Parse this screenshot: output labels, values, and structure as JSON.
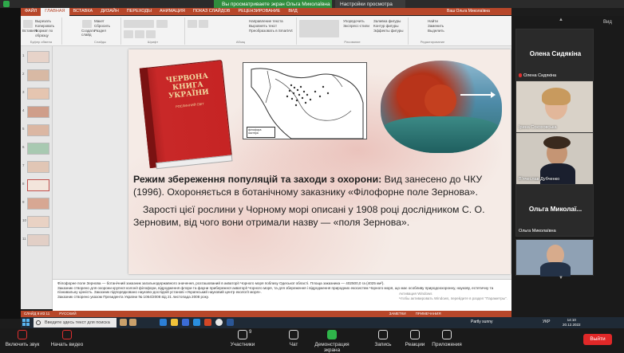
{
  "zoom": {
    "share_banner": "Вы просматриваете экран Ольга Миколаївна",
    "view_options": "Настройки просмотра",
    "view_label": "Вид",
    "toolbar": [
      {
        "label": "Включить звук",
        "icon": "mic-muted-icon"
      },
      {
        "label": "Начать видео",
        "icon": "video-off-icon"
      },
      {
        "label": "Участники",
        "icon": "participants-icon",
        "count": "9"
      },
      {
        "label": "Чат",
        "icon": "chat-icon"
      },
      {
        "label": "Демонстрация экрана",
        "icon": "share-screen-icon"
      },
      {
        "label": "Запись",
        "icon": "record-icon"
      },
      {
        "label": "Реакции",
        "icon": "reactions-icon"
      },
      {
        "label": "Приложения",
        "icon": "apps-icon"
      }
    ],
    "end_label": "Выйти",
    "participants": [
      {
        "name": "Олена Сидякіна",
        "label": "Олена Сидякіна",
        "video": false
      },
      {
        "name": "",
        "label": "Ірина Сокоховська",
        "video": true
      },
      {
        "name": "",
        "label": "В'ячеслав Дубченко",
        "video": true
      },
      {
        "name": "Ольга Миколаї...",
        "label": "Ольга Миколаївна",
        "video": false
      },
      {
        "name": "",
        "label": "",
        "video": true
      }
    ]
  },
  "ppt": {
    "tabs": [
      "ФАЙЛ",
      "ГЛАВНАЯ",
      "ВСТАВКА",
      "ДИЗАЙН",
      "ПЕРЕХОДЫ",
      "АНИМАЦИЯ",
      "ПОКАЗ СЛАЙДОВ",
      "РЕЦЕНЗИРОВАНИЕ",
      "ВИД"
    ],
    "active_tab": "ГЛАВНАЯ",
    "user": "Ваш Ольга Миколаївна",
    "groups": [
      "Буфер обмена",
      "Слайды",
      "Шрифт",
      "Абзац",
      "Рисование",
      "Редактирование"
    ],
    "group_items": {
      "clipboard": [
        "Вырезать",
        "Копировать",
        "Формат по образцу",
        "Вставить"
      ],
      "slides": [
        "Макет",
        "Сбросить",
        "Раздел",
        "Создать слайд"
      ],
      "paragraph": [
        "Направление текста",
        "Выровнять текст",
        "Преобразовать в SmartArt"
      ],
      "drawing": [
        "Заливка фигуры",
        "Контур фигуры",
        "Эффекты фигуры",
        "Упорядочить",
        "Экспресс-стили"
      ],
      "editing": [
        "Найти",
        "Заменить",
        "Выделить"
      ]
    },
    "slide_numbers": [
      "1",
      "2",
      "3",
      "4",
      "5",
      "6",
      "7",
      "8",
      "9",
      "10",
      "11"
    ],
    "selected_slide": "8",
    "status": [
      "СЛАЙД 8 ИЗ 11",
      "РУССКИЙ",
      "ЗАМЕТКИ",
      "ПРИМЕЧАНИЯ"
    ],
    "activate_windows": [
      "Активация Windows",
      "Чтобы активировать Windows, перейдите в раздел \"Параметры\"."
    ]
  },
  "slide": {
    "book_title": "ЧЕРВОНА КНИГА УКРАЇНИ",
    "book_subtitle": "РОСЛИННИЙ СВІТ",
    "map_legend": [
      "філофора",
      "зостера"
    ],
    "bold_intro": "Режим збереження популяцій та заходи з охорони:",
    "para1_rest": " Вид занесено до ЧКУ (1996). Охороняється в ботанічному заказнику «Філофорне поле Зернова».",
    "para2": "Зарості цієї рослини у Чорному морі описані у 1908 році дослідником С. О. Зерновим, від чого вони отримали назву — «поля Зернова»."
  },
  "notes": [
    "Філофорне поле Зернова — ботанічний заказник загальнодержавного значення, розташований в акваторії Чорного моря поблизу Одеської області. Площа заказника — 402500,0 га (4025 км²).",
    "Заказник створено для охорони крупної колонії філофори, відродження флори та фауни прибережної акваторії Чорного моря, та для збереження і відродження природних екосистем Чорного моря, що має особливу природоохоронну, наукову, естетичну та",
    "пізнавальну цінність. Заказник підпорядковано науково-дослідній установі «Український науковий центр екології моря».",
    "Заказник створено указом Президента України № 1064/2008 від 21 листопада 2008 року."
  ],
  "taskbar": {
    "search_placeholder": "Введите здесь текст для поиска",
    "weather": "Partly sunny",
    "lang": "УКР",
    "time": "14:10",
    "date": "20.12.2022"
  }
}
